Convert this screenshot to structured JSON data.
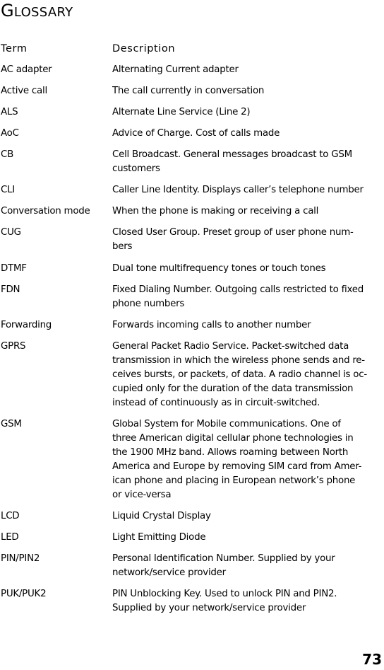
{
  "page": {
    "title_first_letter": "G",
    "title_rest": "lossary",
    "page_number": "73"
  },
  "table": {
    "headers": {
      "term": "Term",
      "description": "Description"
    },
    "rows": [
      {
        "term": "AC adapter",
        "description": "Alternating Current adapter"
      },
      {
        "term": "Active call",
        "description": "The call currently in conversation"
      },
      {
        "term": "ALS",
        "description": "Alternate Line Service (Line 2)"
      },
      {
        "term": "AoC",
        "description": "Advice of Charge. Cost of calls made"
      },
      {
        "term": "CB",
        "description": "Cell Broadcast. General messages broadcast to GSM\ncustomers"
      },
      {
        "term": "CLI",
        "description": "Caller Line Identity. Displays caller’s telephone number"
      },
      {
        "term": "Conversation mode",
        "description": "When the phone is making or receiving a call"
      },
      {
        "term": "CUG",
        "description": "Closed User Group. Preset group of user phone num-\nbers"
      },
      {
        "term": "DTMF",
        "description": "Dual tone multifrequency tones or touch tones"
      },
      {
        "term": "FDN",
        "description": "Fixed Dialing Number. Outgoing calls restricted to fixed\nphone numbers"
      },
      {
        "term": "Forwarding",
        "description": "Forwards incoming calls to another number"
      },
      {
        "term": "GPRS",
        "description": "General Packet Radio Service. Packet-switched data\ntransmission in which the wireless phone sends and re-\nceives bursts, or packets, of data. A radio channel is oc-\ncupied only for the duration of the data transmission\ninstead of continuously as in circuit-switched."
      },
      {
        "term": "GSM",
        "description": "Global System for Mobile communications. One of\nthree American digital cellular phone technologies in\nthe 1900 MHz band. Allows roaming between North\nAmerica and Europe by removing SIM card from Amer-\nican phone and placing in European network’s phone\nor vice-versa"
      },
      {
        "term": "LCD",
        "description": "Liquid Crystal Display"
      },
      {
        "term": "LED",
        "description": "Light Emitting Diode"
      },
      {
        "term": "PIN/PIN2",
        "description": "Personal Identification Number. Supplied by your\nnetwork/service provider"
      },
      {
        "term": "PUK/PUK2",
        "description": "PIN Unblocking Key. Used to unlock PIN and PIN2.\nSupplied by your network/service provider"
      }
    ]
  }
}
